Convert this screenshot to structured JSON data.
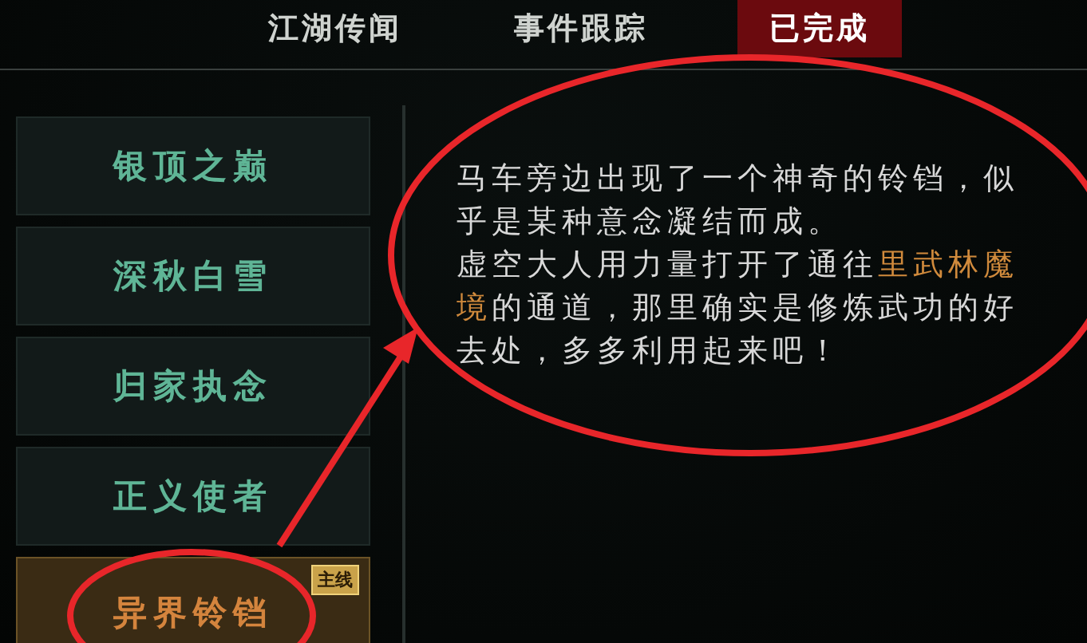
{
  "tabs": [
    {
      "label": "江湖传闻",
      "selected": false
    },
    {
      "label": "事件跟踪",
      "selected": false
    },
    {
      "label": "已完成",
      "selected": true
    }
  ],
  "quests": [
    {
      "name": "银顶之巅",
      "selected": false
    },
    {
      "name": "深秋白雪",
      "selected": false
    },
    {
      "name": "归家执念",
      "selected": false
    },
    {
      "name": "正义使者",
      "selected": false
    },
    {
      "name": "异界铃铛",
      "selected": true,
      "badge": "主线"
    }
  ],
  "description": [
    [
      {
        "text": "马车旁边出现了一个神奇的铃铛，似乎是某种意念凝结而成。",
        "highlight": false
      }
    ],
    [
      {
        "text": "虚空大人用力量打开了通往",
        "highlight": false
      },
      {
        "text": "里武林魔境",
        "highlight": true
      },
      {
        "text": "的通道，那里确实是修炼武功的好去处，多多利用起来吧！",
        "highlight": false
      }
    ]
  ]
}
